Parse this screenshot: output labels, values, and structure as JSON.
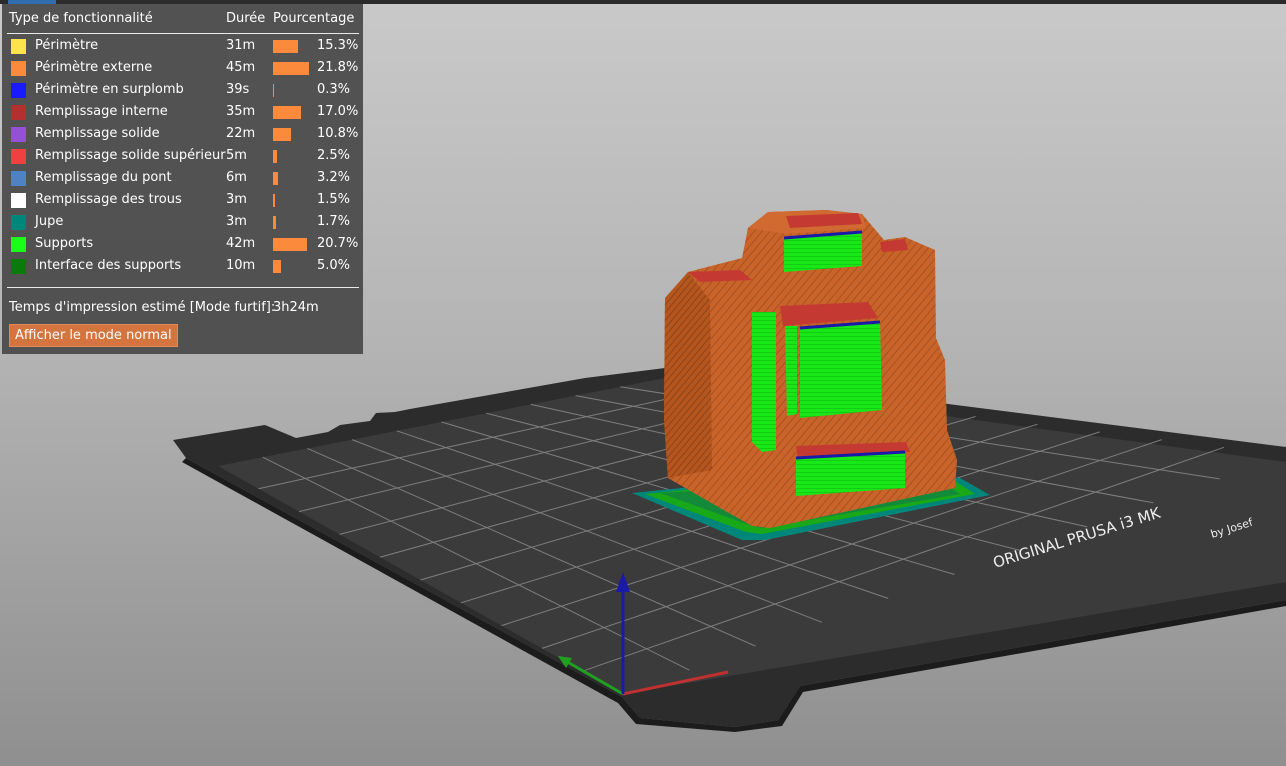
{
  "legend": {
    "headers": {
      "type": "Type de fonctionnalité",
      "time": "Durée",
      "percent": "Pourcentage"
    },
    "rows": [
      {
        "label": "Périmètre",
        "time": "31m",
        "pct": "15.3%",
        "fraction": 0.153,
        "color": "#ffe34d"
      },
      {
        "label": "Périmètre externe",
        "time": "45m",
        "pct": "21.8%",
        "fraction": 0.218,
        "color": "#fb8a3c"
      },
      {
        "label": "Périmètre en surplomb",
        "time": "39s",
        "pct": "0.3%",
        "fraction": 0.003,
        "color": "#1a1aff"
      },
      {
        "label": "Remplissage interne",
        "time": "35m",
        "pct": "17.0%",
        "fraction": 0.17,
        "color": "#b33030"
      },
      {
        "label": "Remplissage solide",
        "time": "22m",
        "pct": "10.8%",
        "fraction": 0.108,
        "color": "#9450d6"
      },
      {
        "label": "Remplissage solide supérieur",
        "time": "5m",
        "pct": "2.5%",
        "fraction": 0.025,
        "color": "#f04040"
      },
      {
        "label": "Remplissage du pont",
        "time": "6m",
        "pct": "3.2%",
        "fraction": 0.032,
        "color": "#4d82c4"
      },
      {
        "label": "Remplissage des trous",
        "time": "3m",
        "pct": "1.5%",
        "fraction": 0.015,
        "color": "#ffffff"
      },
      {
        "label": "Jupe",
        "time": "3m",
        "pct": "1.7%",
        "fraction": 0.017,
        "color": "#00877a"
      },
      {
        "label": "Supports",
        "time": "42m",
        "pct": "20.7%",
        "fraction": 0.207,
        "color": "#18ff18"
      },
      {
        "label": "Interface des supports",
        "time": "10m",
        "pct": "5.0%",
        "fraction": 0.05,
        "color": "#0a7a0a"
      }
    ],
    "estimate_label": "Temps d'impression estimé [Mode furtif]:",
    "estimate_value": "3h24m",
    "mode_button": "Afficher le mode normal"
  },
  "bed": {
    "brand_text": "ORIGINAL PRUSA i3 MK",
    "byline": "by Josef"
  },
  "colors": {
    "bar": "#fb8a3c",
    "panel": "#4d4d4d",
    "model": "#c8642a",
    "support": "#18ff18",
    "axis_z": "#1a1aa8",
    "axis_x": "#c03030",
    "axis_y": "#20a020"
  }
}
